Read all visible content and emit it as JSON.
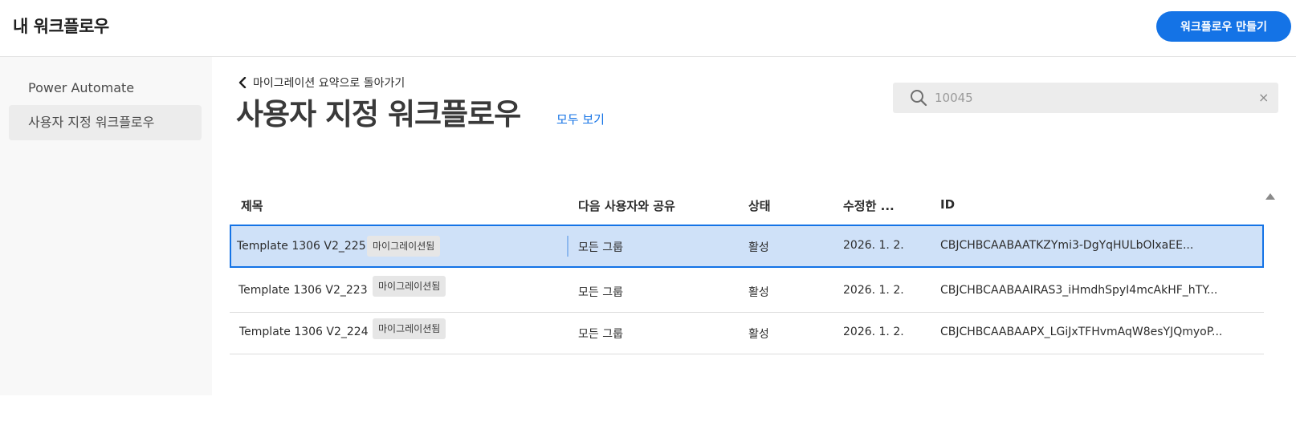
{
  "header": {
    "title": "내 워크플로우",
    "create_button": "워크플로우 만들기"
  },
  "sidebar": {
    "items": [
      {
        "label": "Power Automate"
      },
      {
        "label": "사용자 지정 워크플로우",
        "active": true
      }
    ]
  },
  "main": {
    "back_link": "마이그레이션 요약으로 돌아가기",
    "title": "사용자 지정 워크플로우",
    "view_all": "모두 보기"
  },
  "search": {
    "value": "",
    "placeholder": "10045",
    "clear_icon": "close-icon"
  },
  "table": {
    "columns": [
      "제목",
      "다음 사용자와 공유",
      "상태",
      "수정한 ...",
      "ID"
    ],
    "rows": [
      {
        "title": "Template 1306 V2_225",
        "badge": "마이그레이션됨",
        "shared": "모든 그룹",
        "status": "활성",
        "modified": "2026. 1. 2.",
        "id": "CBJCHBCAABAATKZYmi3-DgYqHULbOlxaEE...",
        "selected": true
      },
      {
        "title": "Template 1306 V2_223",
        "badge": "마이그레이션됨",
        "shared": "모든 그룹",
        "status": "활성",
        "modified": "2026. 1. 2.",
        "id": "CBJCHBCAABAAIRAS3_iHmdhSpyI4mcAkHF_hTY..."
      },
      {
        "title": "Template 1306 V2_224",
        "badge": "마이그레이션됨",
        "shared": "모든 그룹",
        "status": "활성",
        "modified": "2026. 1. 2.",
        "id": "CBJCHBCAABAAPX_LGiJxTFHvmAqW8esYJQmyoP..."
      }
    ]
  },
  "colors": {
    "accent": "#1473e6",
    "selected_row": "#cfe1f8",
    "sidebar_bg": "#f8f8f8"
  }
}
